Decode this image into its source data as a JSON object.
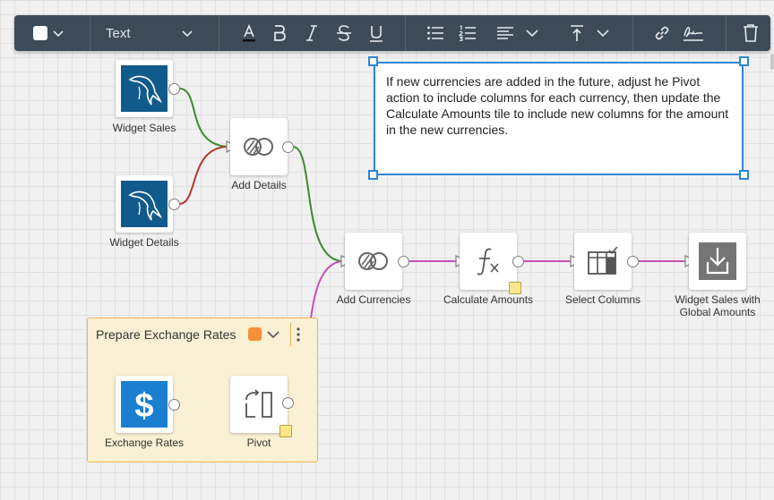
{
  "toolbar": {
    "text_style_label": "Text"
  },
  "note": {
    "text": "If new currencies are added in the future, adjust he Pivot action to include columns for each currency, then update the Calculate Amounts tile to include new columns for the amount in the new currencies."
  },
  "group": {
    "title": "Prepare Exchange Rates",
    "color": "#f7903a"
  },
  "tiles": {
    "widget_sales": "Widget Sales",
    "widget_details": "Widget Details",
    "add_details": "Add Details",
    "add_currencies": "Add Currencies",
    "calculate_amounts": "Calculate Amounts",
    "select_columns": "Select Columns",
    "widget_sales_global_1": "Widget Sales with",
    "widget_sales_global_2": "Global Amounts",
    "exchange_rates": "Exchange Rates",
    "pivot": "Pivot"
  },
  "colors": {
    "toolbar_bg": "#3d4b58",
    "selection_blue": "#2f86d1",
    "wire_green": "#3e8a2f",
    "wire_red": "#b33a2c",
    "wire_magenta": "#c651b2",
    "mysql_blue": "#115a8c",
    "dollar_blue": "#1b7fcf",
    "group_border": "#f2b24d",
    "group_bg": "#faf0d3"
  },
  "icons": [
    "square-color-icon",
    "chevron-down-icon",
    "font-color-icon",
    "bold-icon",
    "italic-icon",
    "strikethrough-icon",
    "underline-icon",
    "bullet-list-icon",
    "numbered-list-icon",
    "align-left-icon",
    "vertical-align-top-icon",
    "link-icon",
    "signature-icon",
    "trash-icon",
    "mysql-dolphin-icon",
    "join-icon",
    "formula-icon",
    "select-columns-icon",
    "output-icon",
    "dollar-icon",
    "pivot-icon",
    "sticky-note-icon",
    "more-vertical-icon"
  ]
}
